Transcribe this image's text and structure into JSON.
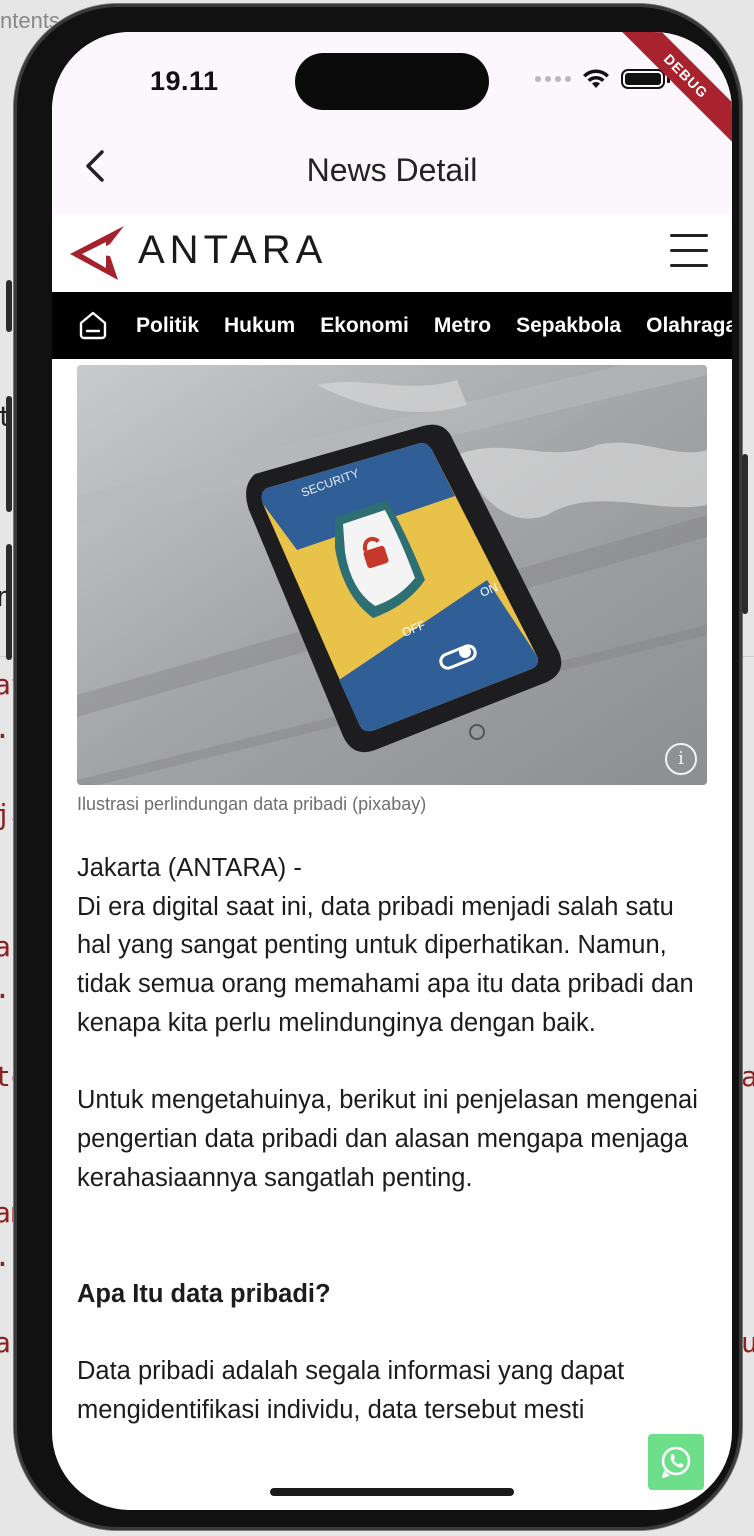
{
  "background": {
    "top_text": "ntents",
    "fragments": [
      "ti",
      "nt",
      "at",
      ".p",
      "ja",
      "an",
      ".p",
      "te",
      "ua",
      "am",
      ".p",
      "an",
      "bu"
    ]
  },
  "status_bar": {
    "time": "19.11",
    "debug_label": "DEBUG"
  },
  "app_bar": {
    "title": "News Detail"
  },
  "site": {
    "logo_text": "ANTARA",
    "brand_color": "#a3222c"
  },
  "nav": {
    "items": [
      "Politik",
      "Hukum",
      "Ekonomi",
      "Metro",
      "Sepakbola",
      "Olahraga"
    ]
  },
  "article": {
    "image_caption": "Ilustrasi perlindungan data pribadi (pixabay)",
    "image_text": {
      "security": "SECURITY",
      "off": "OFF",
      "on": "ON"
    },
    "dateline": "Jakarta (ANTARA) -",
    "para1": "Di era digital saat ini, data pribadi menjadi salah satu hal yang sangat penting untuk diperhatikan. Namun, tidak semua orang memahami apa itu data pribadi dan kenapa kita perlu melindunginya dengan baik.",
    "para2": "Untuk mengetahuinya, berikut ini penjelasan mengenai pengertian data pribadi dan alasan mengapa menjaga kerahasiaannya sangatlah penting.",
    "heading": "Apa Itu data pribadi?",
    "para3": "Data pribadi adalah segala informasi yang dapat mengidentifikasi individu, data tersebut mesti"
  }
}
